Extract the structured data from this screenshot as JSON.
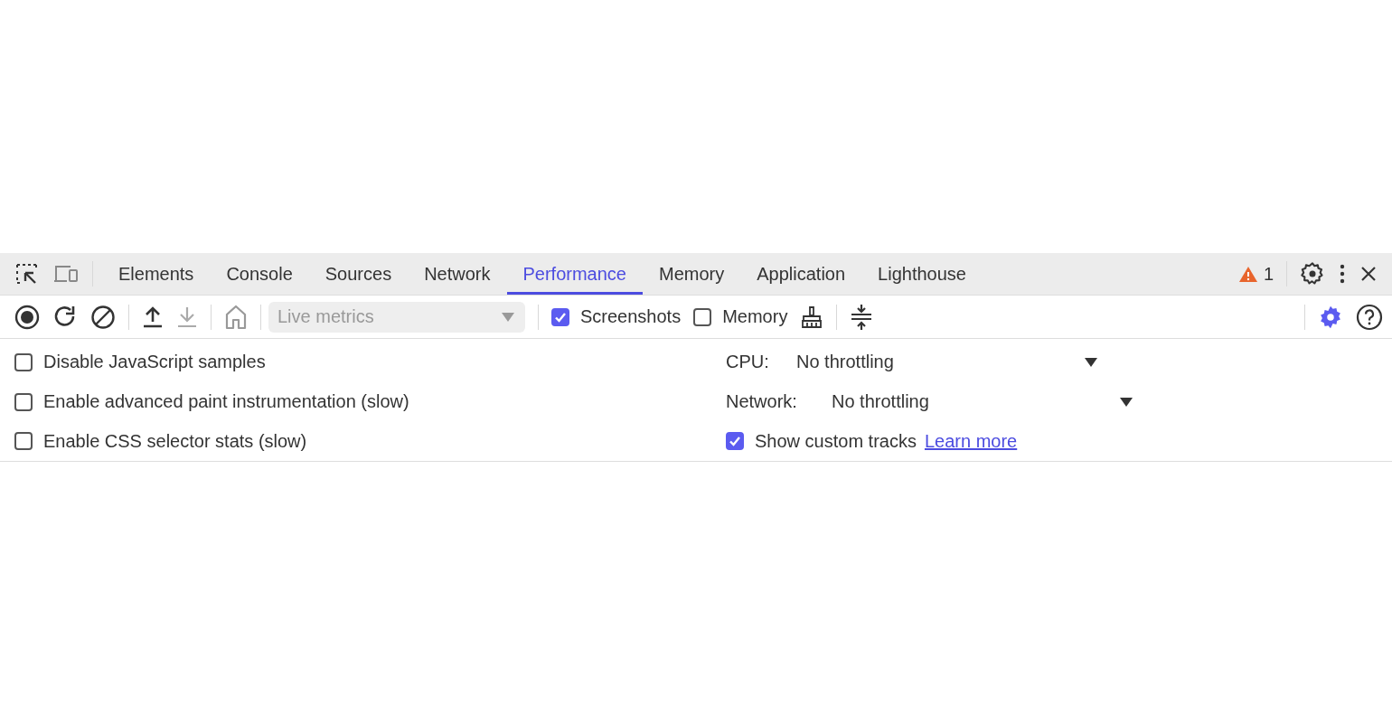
{
  "tabs": [
    {
      "label": "Elements",
      "selected": false
    },
    {
      "label": "Console",
      "selected": false
    },
    {
      "label": "Sources",
      "selected": false
    },
    {
      "label": "Network",
      "selected": false
    },
    {
      "label": "Performance",
      "selected": true
    },
    {
      "label": "Memory",
      "selected": false
    },
    {
      "label": "Application",
      "selected": false
    },
    {
      "label": "Lighthouse",
      "selected": false
    }
  ],
  "warnings": {
    "count": "1"
  },
  "toolbar": {
    "buttons": [
      {
        "kind": "record",
        "disabled": false
      },
      {
        "kind": "reload",
        "disabled": false
      },
      {
        "kind": "clear",
        "disabled": false
      },
      {
        "kind": "upload",
        "disabled": false
      },
      {
        "kind": "download",
        "disabled": true
      },
      {
        "kind": "home",
        "disabled": true
      }
    ],
    "live_metrics": {
      "value": "Live metrics",
      "disabled": true
    },
    "checkboxes": [
      {
        "label": "Screenshots",
        "checked": true
      },
      {
        "label": "Memory",
        "checked": false
      }
    ]
  },
  "settings": {
    "left": [
      {
        "label": "Disable JavaScript samples",
        "checked": false
      },
      {
        "label": "Enable advanced paint instrumentation (slow)",
        "checked": false
      },
      {
        "label": "Enable CSS selector stats (slow)",
        "checked": false
      }
    ],
    "cpu": {
      "label": "CPU:",
      "value": "No throttling"
    },
    "network": {
      "label": "Network:",
      "value": "No throttling"
    },
    "custom_tracks": {
      "label": "Show custom tracks",
      "checked": true,
      "link": "Learn more"
    }
  }
}
